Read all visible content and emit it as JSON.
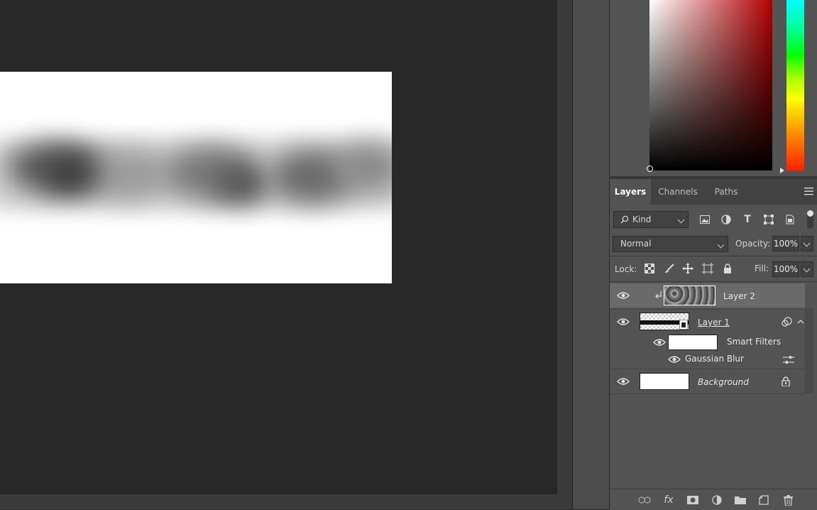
{
  "layers_panel": {
    "tabs": [
      {
        "label": "Layers",
        "active": true
      },
      {
        "label": "Channels",
        "active": false
      },
      {
        "label": "Paths",
        "active": false
      }
    ],
    "filter_kind": "Kind",
    "blend_mode": "Normal",
    "opacity_label": "Opacity:",
    "opacity_value": "100%",
    "lock_label": "Lock:",
    "fill_label": "Fill:",
    "fill_value": "100%",
    "layers": [
      {
        "name": "Layer 2",
        "selected": true,
        "clipped": true
      },
      {
        "name": "Layer 1",
        "smart_object": true
      },
      {
        "name": "Smart Filters"
      },
      {
        "name": "Gaussian Blur"
      },
      {
        "name": "Background",
        "locked": true
      }
    ],
    "filter_icons": [
      "image-filter-icon",
      "adjustment-filter-icon",
      "type-filter-icon",
      "shape-filter-icon",
      "smart-object-filter-icon"
    ],
    "lock_icons": [
      "lock-transparent-pixels-icon",
      "lock-image-pixels-icon",
      "lock-position-icon",
      "lock-artboard-icon",
      "lock-all-icon"
    ],
    "bottom_icons": [
      "link-layers-icon",
      "fx-icon",
      "add-mask-icon",
      "new-adjustment-layer-icon",
      "new-group-icon",
      "new-layer-icon",
      "delete-layer-icon"
    ],
    "fx_label": "fx"
  },
  "colors": {
    "canvas_bg": "#282828",
    "panel_bg": "#535353",
    "selected_layer": "#6a6a6a",
    "picker_hue": "#b20000"
  }
}
